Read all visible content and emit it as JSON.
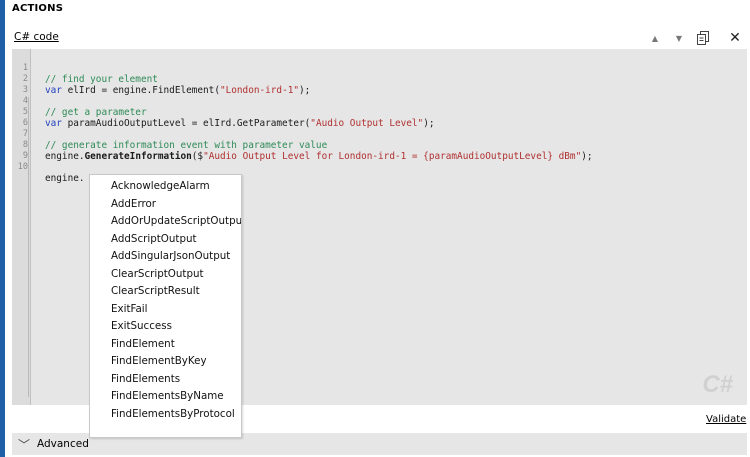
{
  "section": {
    "title": "ACTIONS"
  },
  "editor": {
    "code_label": "C# code",
    "toolbar": {
      "up_icon": "▲",
      "down_icon": "▼",
      "copy_icon": "copy-icon",
      "close_icon": "✕"
    },
    "line_numbers": [
      "1",
      "2",
      "3",
      "4",
      "5",
      "6",
      "7",
      "8",
      "9",
      "10"
    ],
    "lines": {
      "l1": {
        "comment": "// find your element"
      },
      "l2": {
        "kw": "var",
        "code_a": " elIrd = engine.FindElement(",
        "str": "\"London-ird-1\"",
        "code_b": ");"
      },
      "l4": {
        "comment": "// get a parameter"
      },
      "l5": {
        "kw": "var",
        "code_a": " paramAudioOutputLevel = elIrd.GetParameter(",
        "str": "\"Audio Output Level\"",
        "code_b": ");"
      },
      "l7": {
        "comment": "// generate information event with parameter value"
      },
      "l8": {
        "code_a": "engine.",
        "method": "GenerateInformation",
        "code_b": "($",
        "str": "\"Audio Output Level for London-ird-1 = {paramAudioOutputLevel} dBm\"",
        "code_c": ");"
      },
      "l10": {
        "code_a": "engine."
      }
    },
    "watermark": "C#"
  },
  "autocomplete": {
    "items": [
      "AcknowledgeAlarm",
      "AddError",
      "AddOrUpdateScriptOutput",
      "AddScriptOutput",
      "AddSingularJsonOutput",
      "ClearScriptOutput",
      "ClearScriptResult",
      "ExitFail",
      "ExitSuccess",
      "FindElement",
      "FindElementByKey",
      "FindElements",
      "FindElementsByName",
      "FindElementsByProtocol"
    ]
  },
  "validate": {
    "label": "Validate"
  },
  "advanced": {
    "label": "Advanced",
    "chevron": "﹀"
  },
  "colors": {
    "accent": "#1f5fa8",
    "editor_bg": "#e6e6e6",
    "comment": "#2e8b57",
    "keyword": "#1f3fbf",
    "string": "#b03030"
  }
}
